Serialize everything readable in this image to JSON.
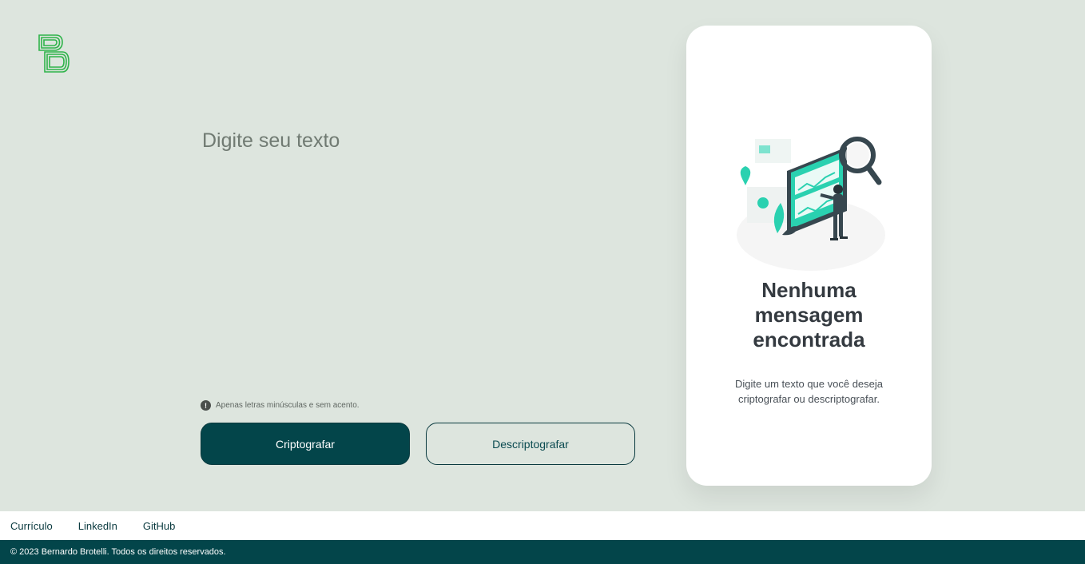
{
  "logo": {
    "icon": "bb-logo-icon",
    "color": "#2fb34a"
  },
  "input": {
    "placeholder": "Digite seu texto",
    "value": ""
  },
  "hint": {
    "icon": "warning-icon",
    "text": "Apenas letras minúsculas e sem acento."
  },
  "actions": {
    "encrypt_label": "Criptografar",
    "decrypt_label": "Descriptografar",
    "primary_color": "#03454a"
  },
  "output_card": {
    "illustration": "magnifier-illustration",
    "title": "Nenhuma mensagem encontrada",
    "description": "Digite um texto que você deseja criptografar ou descriptografar."
  },
  "footer": {
    "links": [
      "Currículo",
      "LinkedIn",
      "GitHub"
    ],
    "copyright": "© 2023 Bernardo Brotelli. Todos os direitos reservados."
  }
}
